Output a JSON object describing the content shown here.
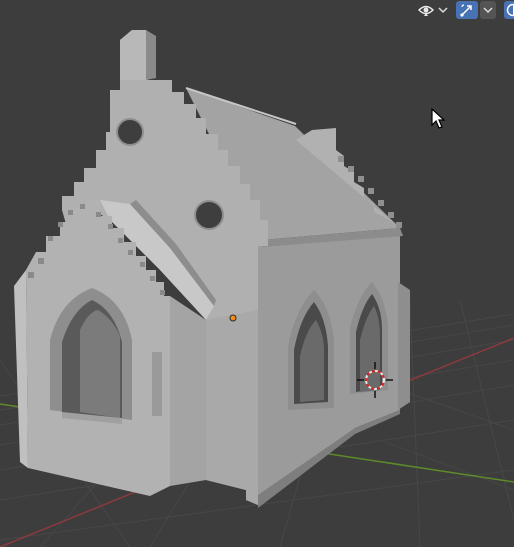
{
  "viewport": {
    "background": "#3d3d3d",
    "grid_color": "#4a4a4a",
    "x_axis_color": "#8c3a3f",
    "y_axis_color": "#5d8a2a"
  },
  "header": {
    "buttons": [
      {
        "name": "visibility-eye-icon",
        "active": false
      },
      {
        "name": "visibility-dropdown-chevron-icon",
        "active": false
      },
      {
        "name": "gizmo-toggle-icon",
        "active": true
      },
      {
        "name": "gizmo-dropdown-chevron-icon",
        "active": false
      },
      {
        "name": "overlay-toggle-icon",
        "active": true
      }
    ],
    "accent_color": "#4772b3"
  },
  "scene": {
    "model": "church-mesh",
    "mesh_color": "#a7a7a7",
    "origin_color": "#f28d1a",
    "cursor": "3d-cursor-icon"
  }
}
